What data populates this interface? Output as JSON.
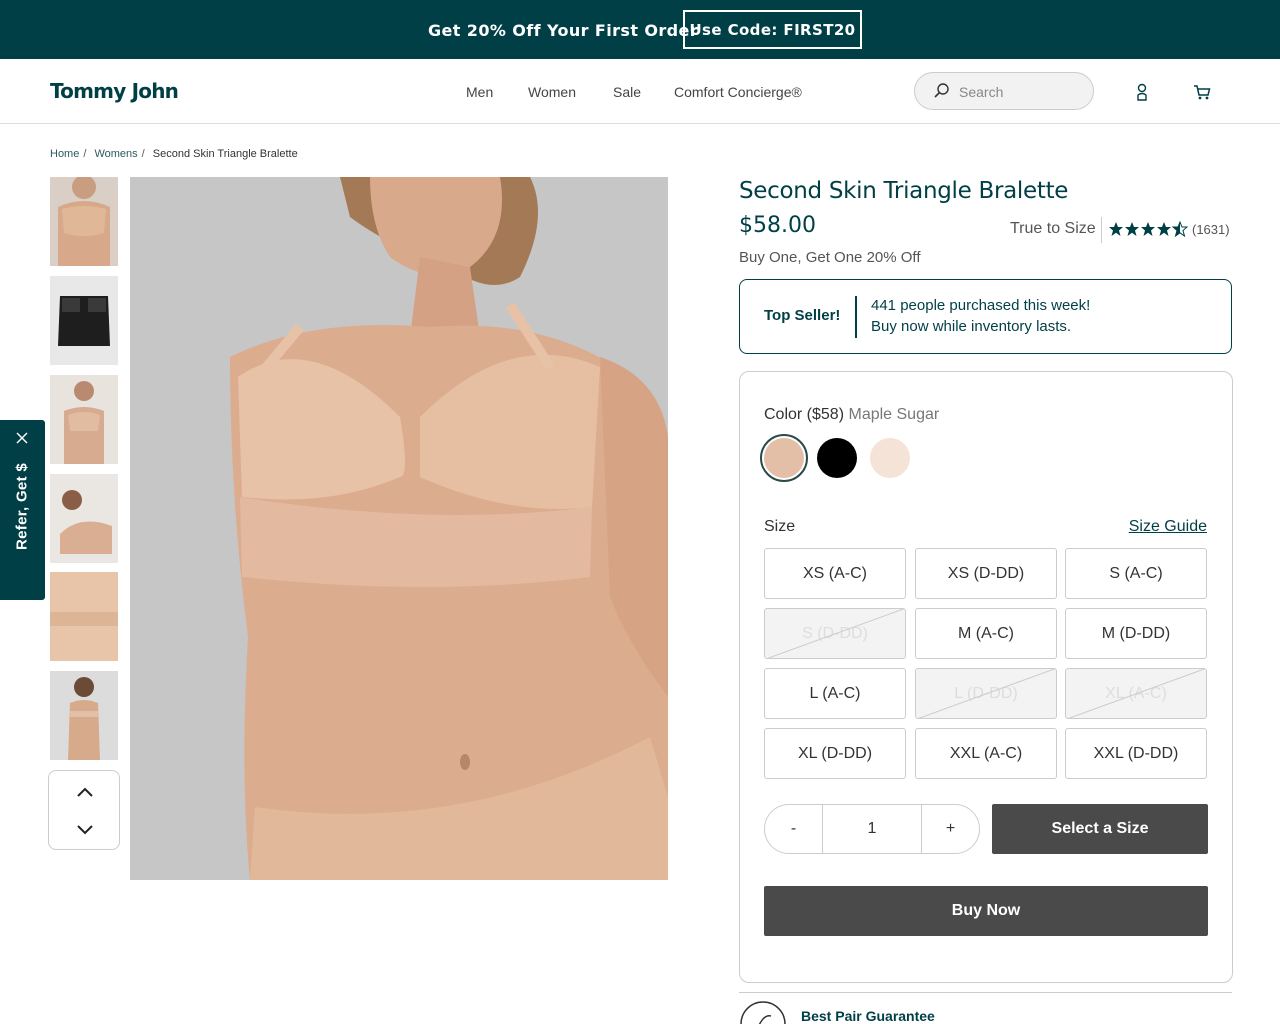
{
  "promo": {
    "text": "Get 20% Off Your First Order",
    "code": "Use Code: FIRST20"
  },
  "header": {
    "logo": "Tommy John",
    "nav": [
      "Men",
      "Women",
      "Sale",
      "Comfort Concierge®"
    ],
    "search_placeholder": "Search"
  },
  "breadcrumb": [
    "Home",
    "Womens",
    "Second Skin Triangle Bralette"
  ],
  "refer": {
    "label": "Refer, Get $"
  },
  "product": {
    "title": "Second Skin Triangle Bralette",
    "price": "$58.00",
    "fit": "True to Size",
    "rating": 4.5,
    "review_count": "(1631)",
    "promo_line": "Buy One, Get One 20% Off"
  },
  "top_seller": {
    "label": "Top Seller!",
    "line1": "441 people purchased this week!",
    "line2": "Buy now while inventory lasts."
  },
  "options": {
    "color_label": "Color ($58)",
    "color_name": "Maple Sugar",
    "swatches": [
      {
        "name": "Maple Sugar",
        "color": "#e2bfa6",
        "selected": true
      },
      {
        "name": "Black",
        "color": "#000000",
        "selected": false
      },
      {
        "name": "Light",
        "color": "#f5e3d8",
        "selected": false
      }
    ],
    "size_label": "Size",
    "size_guide": "Size Guide",
    "sizes": [
      {
        "label": "XS (A-C)",
        "available": true
      },
      {
        "label": "XS (D-DD)",
        "available": true
      },
      {
        "label": "S (A-C)",
        "available": true
      },
      {
        "label": "S (D-DD)",
        "available": false
      },
      {
        "label": "M (A-C)",
        "available": true
      },
      {
        "label": "M (D-DD)",
        "available": true
      },
      {
        "label": "L (A-C)",
        "available": true
      },
      {
        "label": "L (D-DD)",
        "available": false
      },
      {
        "label": "XL (A-C)",
        "available": false
      },
      {
        "label": "XL (D-DD)",
        "available": true
      },
      {
        "label": "XXL (A-C)",
        "available": true
      },
      {
        "label": "XXL (D-DD)",
        "available": true
      }
    ],
    "qty_minus": "-",
    "qty_value": "1",
    "qty_plus": "+",
    "select_size": "Select a Size",
    "buy_now": "Buy Now"
  },
  "guarantee": {
    "title": "Best Pair Guarantee"
  },
  "colors": {
    "brand": "#003f46",
    "button": "#4a4a4a"
  }
}
